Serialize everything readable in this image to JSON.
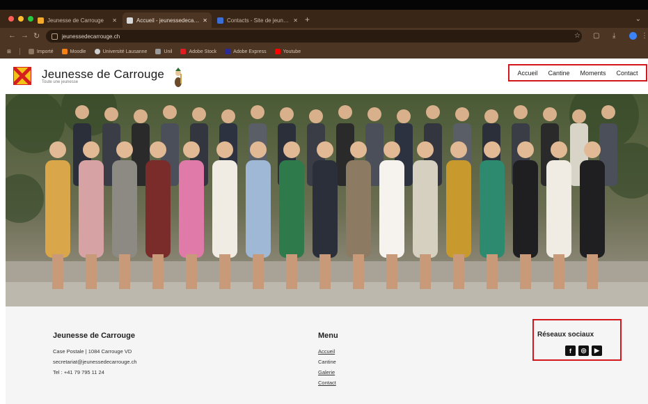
{
  "browser": {
    "tabs": [
      {
        "title": "Jeunesse de Carrouge",
        "active": false
      },
      {
        "title": "Accueil - jeunessedecarrouge.ch",
        "active": true
      },
      {
        "title": "Contacts - Site de jeunesse de Carrouge",
        "active": false
      }
    ],
    "url": "jeunessedecarrouge.ch",
    "bookmarks": [
      {
        "label": "Importé",
        "icon": "folder-icon"
      },
      {
        "label": "Moodle",
        "icon": "moodle-icon"
      },
      {
        "label": "Université Lausanne",
        "icon": "university-icon"
      },
      {
        "label": "Unil",
        "icon": "unil-icon"
      },
      {
        "label": "Adobe Stock",
        "icon": "adobe-icon"
      },
      {
        "label": "Adobe Express",
        "icon": "adobe-express-icon"
      },
      {
        "label": "Youtube",
        "icon": "youtube-icon"
      }
    ]
  },
  "site": {
    "title": "Jeunesse de Carrouge",
    "subtitle": "Toute une jeunesse",
    "nav": [
      "Accueil",
      "Cantine",
      "Moments",
      "Contact"
    ]
  },
  "footer": {
    "org_name": "Jeunesse de Carrouge",
    "address": "Case Postale | 1084 Carrouge VD",
    "email": "secretariat@jeunessedecarrouge.ch",
    "phone": "Tel : +41 79 795 11 24",
    "menu_title": "Menu",
    "menu_items": [
      "Accueil",
      "Cantine",
      "Galerie",
      "Contact"
    ],
    "social_title": "Réseaux sociaux",
    "social_icons": [
      "facebook-icon",
      "instagram-icon",
      "youtube-icon"
    ]
  },
  "colors": {
    "browser_frame": "#3a2616",
    "highlight_border": "#d3151c",
    "footer_bg": "#f5f5f5"
  }
}
